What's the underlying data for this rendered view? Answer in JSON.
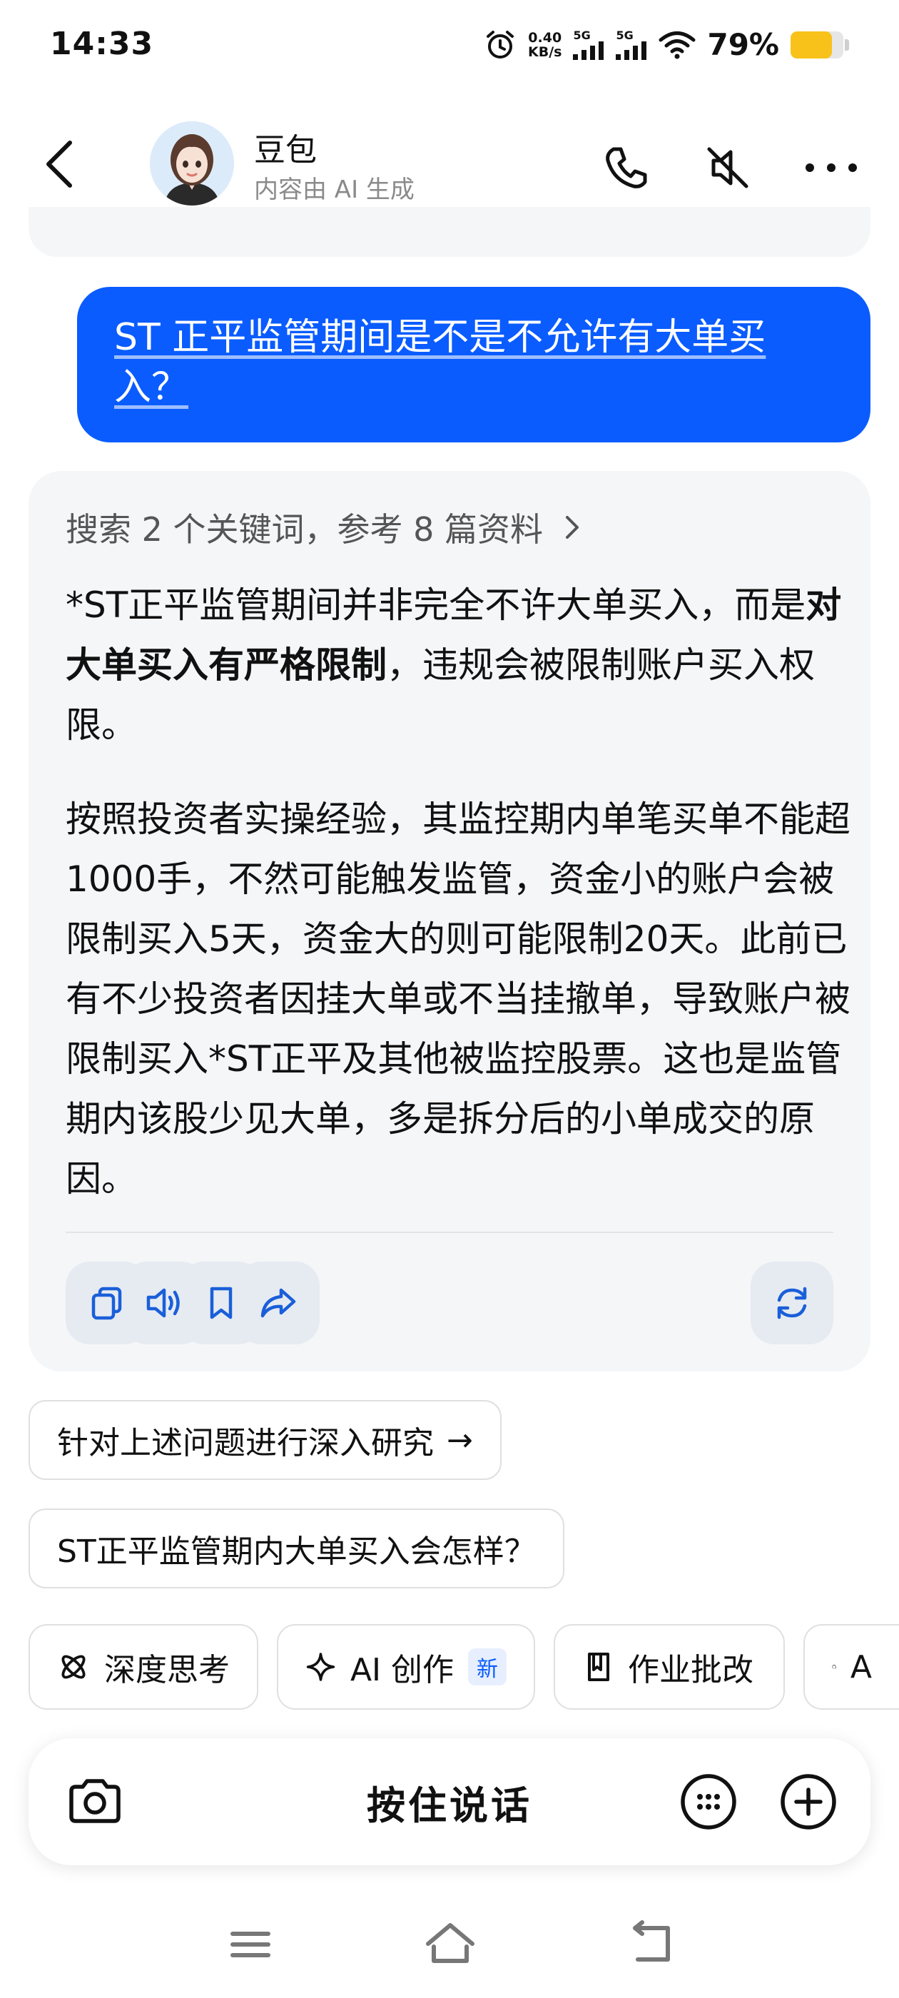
{
  "status_bar": {
    "time": "14:33",
    "net_speed_value": "0.40",
    "net_speed_unit": "KB/s",
    "sim1": "5G",
    "sim2": "5G",
    "battery_pct": "79%",
    "battery_level": 0.79
  },
  "header": {
    "name": "豆包",
    "subtitle": "内容由 AI 生成"
  },
  "user_message": "ST 正平监管期间是不是不允许有大单买入？",
  "ai_response": {
    "search_ref": "搜索 2 个关键词，参考 8 篇资料",
    "para1_a": "*ST正平监管期间并非完全不许大单买入，而是",
    "para1_bold": "对大单买入有严格限制",
    "para1_b": "，违规会被限制账户买入权限。",
    "para2": "按照投资者实操经验，其监控期内单笔买单不能超1000手，不然可能触发监管，资金小的账户会被限制买入5天，资金大的则可能限制20天。此前已有不少投资者因挂大单或不当挂撤单，导致账户被限制买入*ST正平及其他被监控股票。这也是监管期内该股少见大单，多是拆分后的小单成交的原因。"
  },
  "suggestions": [
    {
      "label": "针对上述问题进行深入研究",
      "arrow": "→"
    },
    {
      "label": "ST正平监管期内大单买入会怎样？"
    }
  ],
  "tools": {
    "deep_think": "深度思考",
    "ai_create": "AI 创作",
    "ai_create_badge": "新",
    "homework": "作业批改",
    "partial": "A"
  },
  "input_bar": {
    "hold_to_talk": "按住说话"
  },
  "colors": {
    "accent": "#0a5cff",
    "battery": "#f8c21b",
    "card_bg": "#f5f6f8"
  }
}
